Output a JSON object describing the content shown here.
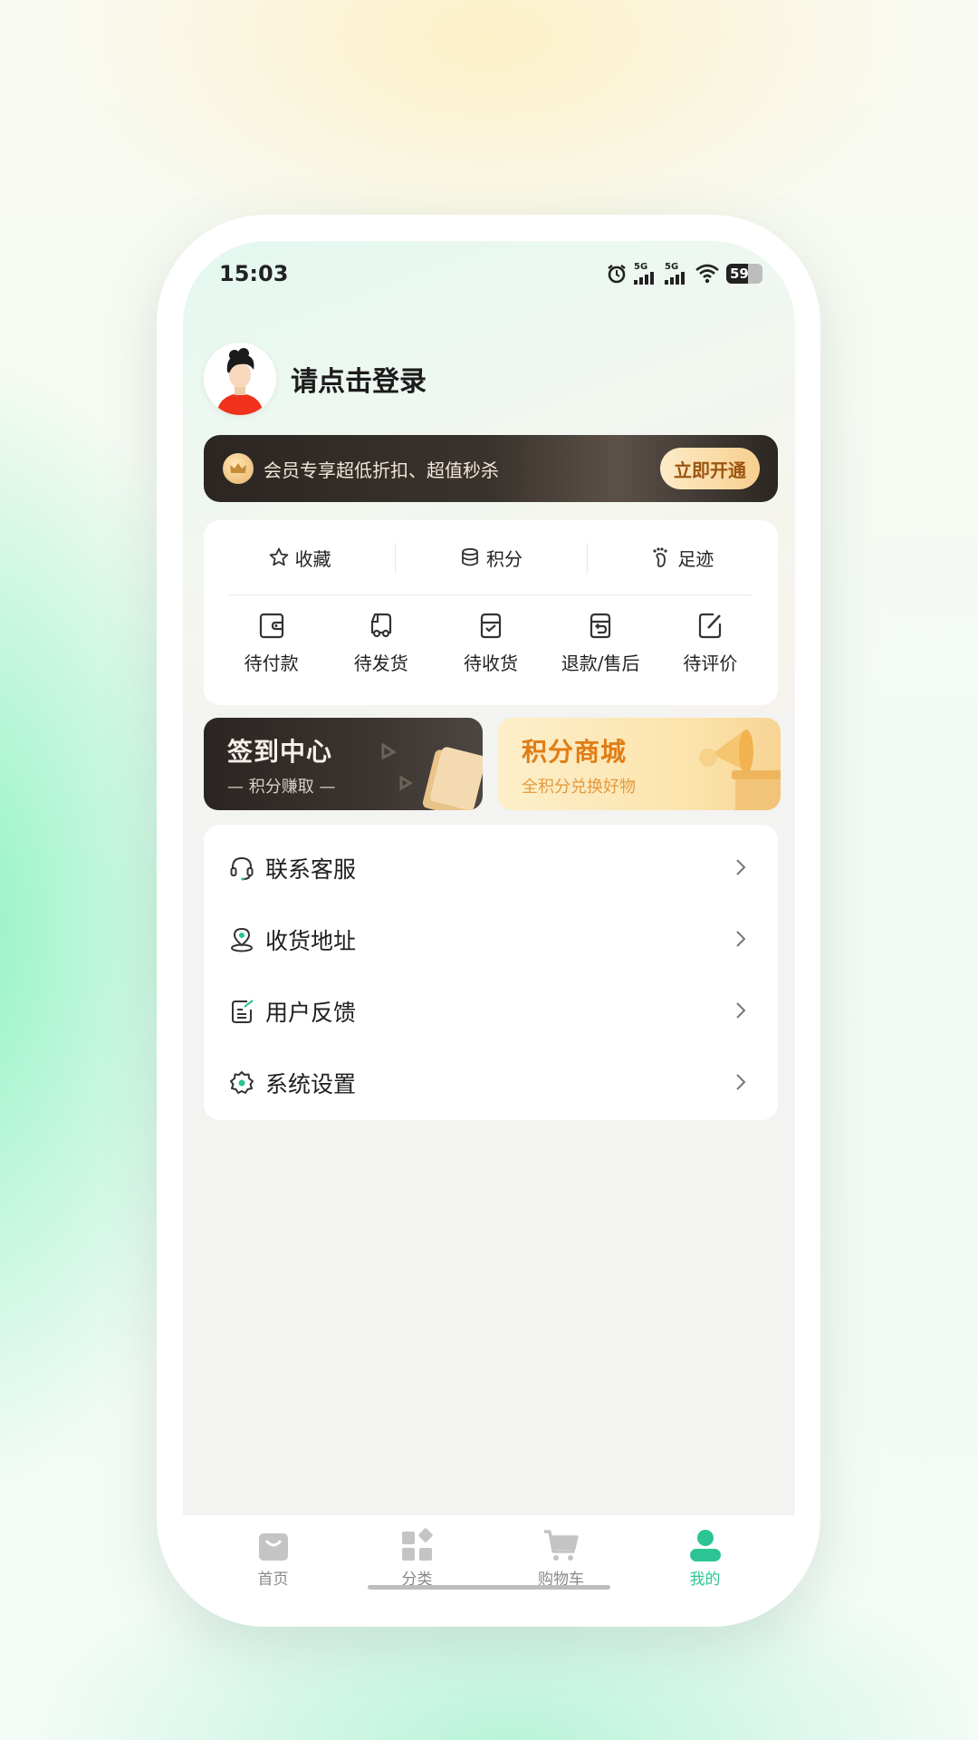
{
  "status_bar": {
    "time": "15:03",
    "network_1": "5G",
    "network_2": "5G",
    "battery": "59"
  },
  "profile": {
    "login_prompt": "请点击登录"
  },
  "vip_banner": {
    "text": "会员专享超低折扣、超值秒杀",
    "button": "立即开通"
  },
  "quick_links": [
    {
      "label": "收藏",
      "icon": "star-icon"
    },
    {
      "label": "积分",
      "icon": "coins-icon"
    },
    {
      "label": "足迹",
      "icon": "footprint-icon"
    }
  ],
  "orders": [
    {
      "label": "待付款",
      "icon": "wallet-icon"
    },
    {
      "label": "待发货",
      "icon": "truck-icon"
    },
    {
      "label": "待收货",
      "icon": "inbox-icon"
    },
    {
      "label": "退款/售后",
      "icon": "return-box-icon"
    },
    {
      "label": "待评价",
      "icon": "edit-note-icon"
    }
  ],
  "promos": {
    "signin": {
      "title": "签到中心",
      "subtitle": "— 积分赚取 —"
    },
    "points_mall": {
      "title": "积分商城",
      "subtitle": "全积分兑换好物"
    }
  },
  "menu": [
    {
      "label": "联系客服",
      "icon": "headset-icon"
    },
    {
      "label": "收货地址",
      "icon": "location-icon"
    },
    {
      "label": "用户反馈",
      "icon": "feedback-icon"
    },
    {
      "label": "系统设置",
      "icon": "settings-icon"
    }
  ],
  "tabbar": [
    {
      "label": "首页",
      "icon": "bag-icon",
      "active": false
    },
    {
      "label": "分类",
      "icon": "category-icon",
      "active": false
    },
    {
      "label": "购物车",
      "icon": "cart-icon",
      "active": false
    },
    {
      "label": "我的",
      "icon": "user-icon",
      "active": true
    }
  ],
  "colors": {
    "accent": "#2cc495",
    "vip_dark": "#2b2622",
    "vip_gold": "#f7cf8e",
    "mall_orange": "#e07d17"
  }
}
